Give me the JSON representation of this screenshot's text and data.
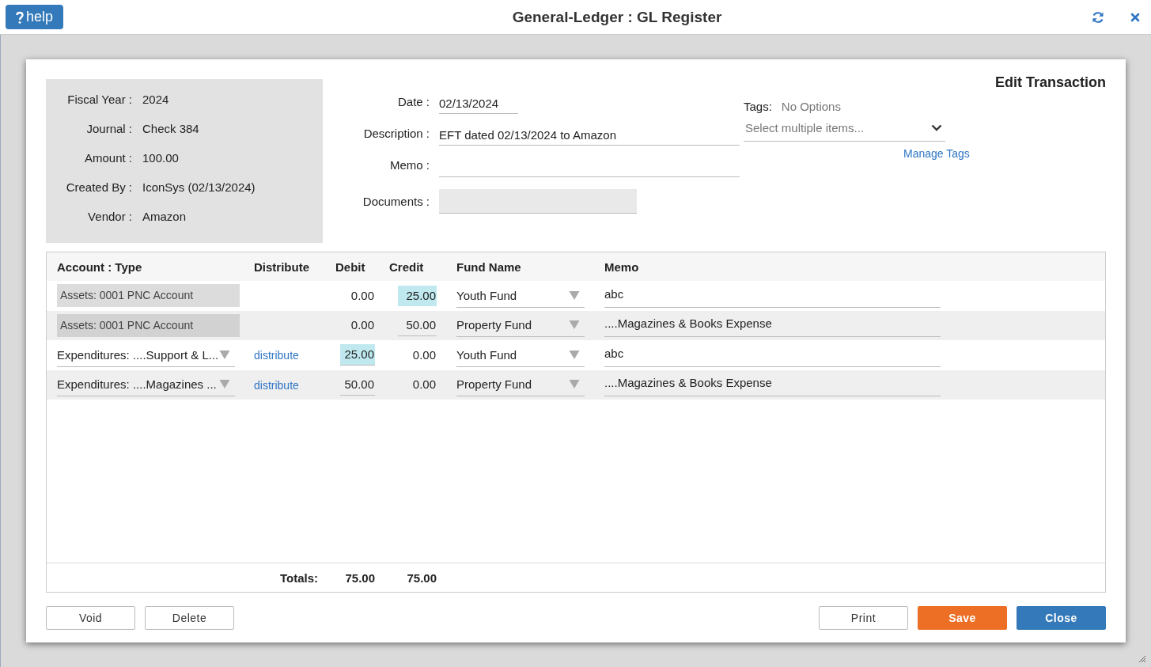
{
  "window": {
    "title": "General-Ledger : GL Register",
    "help_button": "help"
  },
  "dialog": {
    "title": "Edit Transaction",
    "info": [
      {
        "label": "Fiscal Year :",
        "value": "2024"
      },
      {
        "label": "Journal :",
        "value": "Check 384"
      },
      {
        "label": "Amount :",
        "value": "100.00"
      },
      {
        "label": "Created By :",
        "value": "IconSys (02/13/2024)"
      },
      {
        "label": "Vendor :",
        "value": "Amazon"
      }
    ],
    "fields": [
      {
        "label": "Date :",
        "value": "02/13/2024",
        "kind": "short"
      },
      {
        "label": "Description :",
        "value": "EFT dated 02/13/2024 to Amazon",
        "kind": "text"
      },
      {
        "label": "Memo :",
        "kind": "text"
      },
      {
        "label": "Documents :",
        "kind": "upload"
      }
    ],
    "tags": {
      "label": "Tags:",
      "note": "No Options",
      "placeholder": "Select multiple items...",
      "link": "Manage Tags"
    },
    "table": {
      "columns": [
        "Account : Type",
        "Distribute",
        "Debit",
        "Credit",
        "Fund Name",
        "Memo"
      ],
      "rows": [
        {
          "account": {
            "value": "Assets: 0001 PNC Account",
            "kind": "readonly"
          },
          "debit": {
            "value": "0.00",
            "editable": false,
            "highlighted": false
          },
          "credit": {
            "value": "25.00",
            "editable": false,
            "highlighted": true
          },
          "fund": "Youth Fund",
          "memo": "abc"
        },
        {
          "account": {
            "value": "Assets: 0001 PNC Account",
            "kind": "readonly"
          },
          "debit": {
            "value": "0.00",
            "editable": false,
            "highlighted": false
          },
          "credit": {
            "value": "50.00",
            "editable": true,
            "highlighted": false
          },
          "fund": "Property Fund",
          "memo": "....Magazines & Books Expense"
        },
        {
          "account": {
            "value": "Expenditures: ....Support & L...",
            "kind": "dropdown"
          },
          "distribute": "distribute",
          "debit": {
            "value": "25.00",
            "editable": true,
            "highlighted": true
          },
          "credit": {
            "value": "0.00",
            "editable": false,
            "highlighted": false
          },
          "fund": "Youth Fund",
          "memo": "abc"
        },
        {
          "account": {
            "value": "Expenditures: ....Magazines ...",
            "kind": "dropdown"
          },
          "distribute": "distribute",
          "debit": {
            "value": "50.00",
            "editable": true,
            "highlighted": false
          },
          "credit": {
            "value": "0.00",
            "editable": false,
            "highlighted": false
          },
          "fund": "Property Fund",
          "memo": "....Magazines & Books Expense"
        }
      ],
      "totals": {
        "label": "Totals:",
        "debit": "75.00",
        "credit": "75.00"
      }
    },
    "buttons": [
      {
        "label": "Void",
        "kind": "plain"
      },
      {
        "label": "Delete",
        "kind": "plain"
      },
      {
        "label": "Print",
        "kind": "plain"
      },
      {
        "label": "Save",
        "kind": "save"
      },
      {
        "label": "Close",
        "kind": "primary"
      }
    ]
  }
}
